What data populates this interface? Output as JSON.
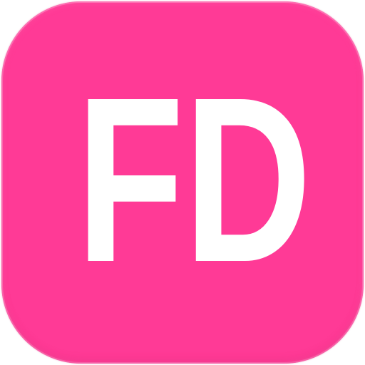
{
  "icon": {
    "monogram": "FD",
    "background_color": "#ff3a96",
    "foreground_color": "#ffffff"
  }
}
